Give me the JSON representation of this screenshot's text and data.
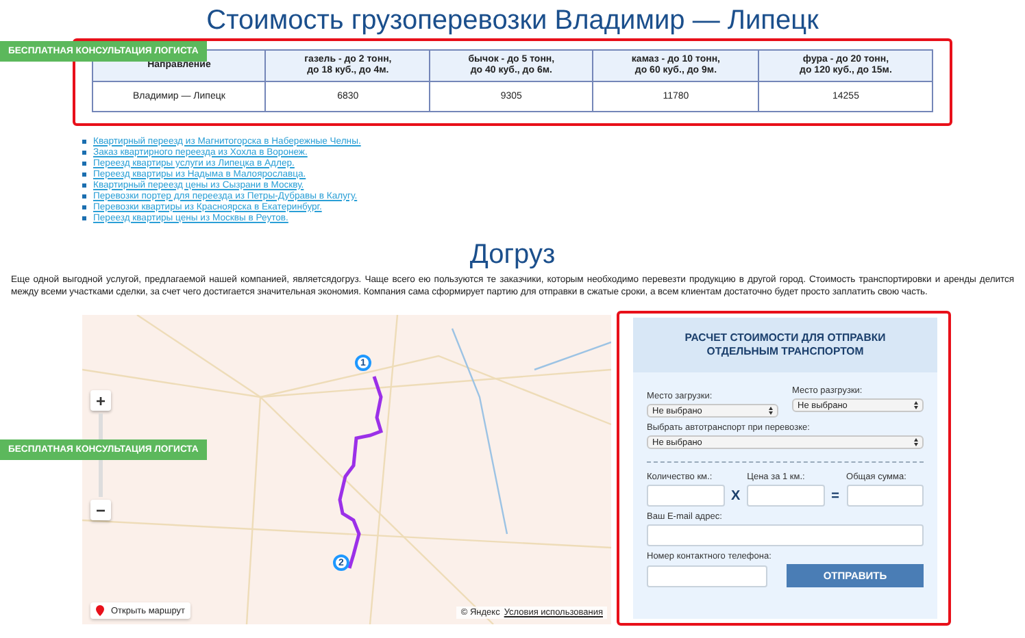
{
  "title": "Стоимость грузоперевозки Владимир — Липецк",
  "consult_badges": [
    "БЕСПЛАТНАЯ КОНСУЛЬТАЦИЯ ЛОГИСТА",
    "БЕСПЛАТНАЯ КОНСУЛЬТАЦИЯ ЛОГИСТА"
  ],
  "price_table": {
    "columns": [
      "Направление",
      "газель - до 2 тонн,\nдо 18 куб., до 4м.",
      "бычок - до 5 тонн,\nдо 40 куб., до 6м.",
      "камаз - до 10 тонн,\nдо 60 куб., до 9м.",
      "фура - до 20 тонн,\nдо 120 куб., до 15м."
    ],
    "rows": [
      [
        "Владимир — Липецк",
        "6830",
        "9305",
        "11780",
        "14255"
      ]
    ]
  },
  "links": [
    "Квартирный переезд из Магнитогорска в Набережные Челны.",
    "Заказ квартирного переезда из Хохла в Воронеж.",
    "Переезд квартиры услуги из Липецка в Адлер.",
    "Переезд квартиры из Надыма в Малоярославца.",
    "Квартирный переезд цены из Сызрани в Москву.",
    "Перевозки портер для переезда из Петры-Дубравы в Калугу.",
    "Перевозки квартиры из Красноярска в Екатеринбург.",
    "Переезд квартиры цены из Москвы в Реутов."
  ],
  "section": {
    "title": "Догруз",
    "text": "Еще одной выгодной услугой, предлагаемой нашей компанией, являетсядогруз. Чаще всего ею пользуются те заказчики, которым необходимо перевезти продукцию в другой город. Стоимость транспортировки и аренды делится между всеми участками сделки, за счет чего достигается значительная экономия. Компания сама сформирует партию для отправки в сжатые сроки, а всем клиентам достаточно будет просто заплатить свою часть."
  },
  "map": {
    "markers": [
      "1",
      "2"
    ],
    "zoom_in": "+",
    "zoom_out": "−",
    "open_route": "Открыть маршрут",
    "copyright": "© Яндекс",
    "terms": "Условия использования"
  },
  "form": {
    "title": "РАСЧЕТ СТОИМОСТИ ДЛЯ ОТПРАВКИ ОТДЕЛЬНЫМ ТРАНСПОРТОМ",
    "load": {
      "label": "Место загрузки:",
      "value": "Не выбрано"
    },
    "unload": {
      "label": "Место разгрузки:",
      "value": "Не выбрано"
    },
    "transport": {
      "label": "Выбрать автотранспорт при перевозке:",
      "value": "Не выбрано"
    },
    "calc": {
      "km_label": "Количество км.:",
      "price_label": "Цена за 1 км.:",
      "total_label": "Общая сумма:",
      "times": "X",
      "equals": "="
    },
    "email_label": "Ваш E-mail адрес:",
    "phone_label": "Номер контактного телефона:",
    "submit": "ОТПРАВИТЬ"
  }
}
